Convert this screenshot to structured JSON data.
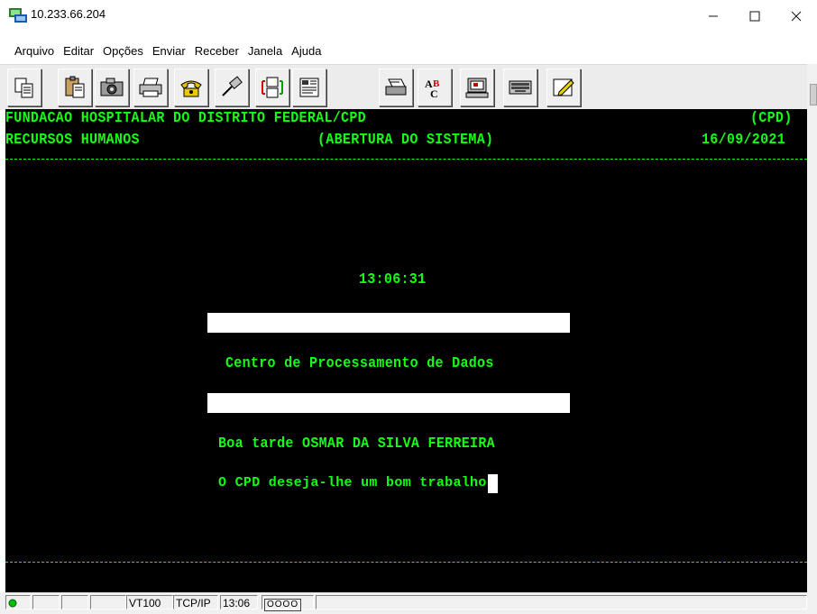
{
  "window": {
    "title": "10.233.66.204",
    "controls": [
      "minimize",
      "maximize",
      "close"
    ]
  },
  "menu": {
    "items": [
      "Arquivo",
      "Editar",
      "Opções",
      "Enviar",
      "Receber",
      "Janela",
      "Ajuda"
    ]
  },
  "toolbar": {
    "buttons": [
      "copy-icon",
      "paste-icon",
      "camera-icon",
      "print-icon",
      "phone-icon",
      "disconnect-icon",
      "transfer-icon",
      "layout-icon",
      "print-screen-icon",
      "spellcheck-icon",
      "computer-icon",
      "keyboard-icon",
      "edit-icon"
    ]
  },
  "terminal": {
    "header_left_1": "FUNDACAO HOSPITALAR DO DISTRITO FEDERAL/CPD",
    "header_right_1": "(CPD)",
    "header_left_2": "RECURSOS HUMANOS",
    "header_center_2": "(ABERTURA DO SISTEMA)",
    "header_right_2": "16/09/2021",
    "clock": "13:06:31",
    "center_title": "Centro de Processamento de Dados",
    "greeting": "Boa tarde OSMAR DA SILVA FERREIRA",
    "message": "O CPD deseja-lhe um bom trabalho",
    "text_color": "#14ff14",
    "background_color": "#000000"
  },
  "status": {
    "terminal_type": "VT100",
    "protocol": "TCP/IP",
    "time": "13:06",
    "indicator": "OOOO"
  }
}
